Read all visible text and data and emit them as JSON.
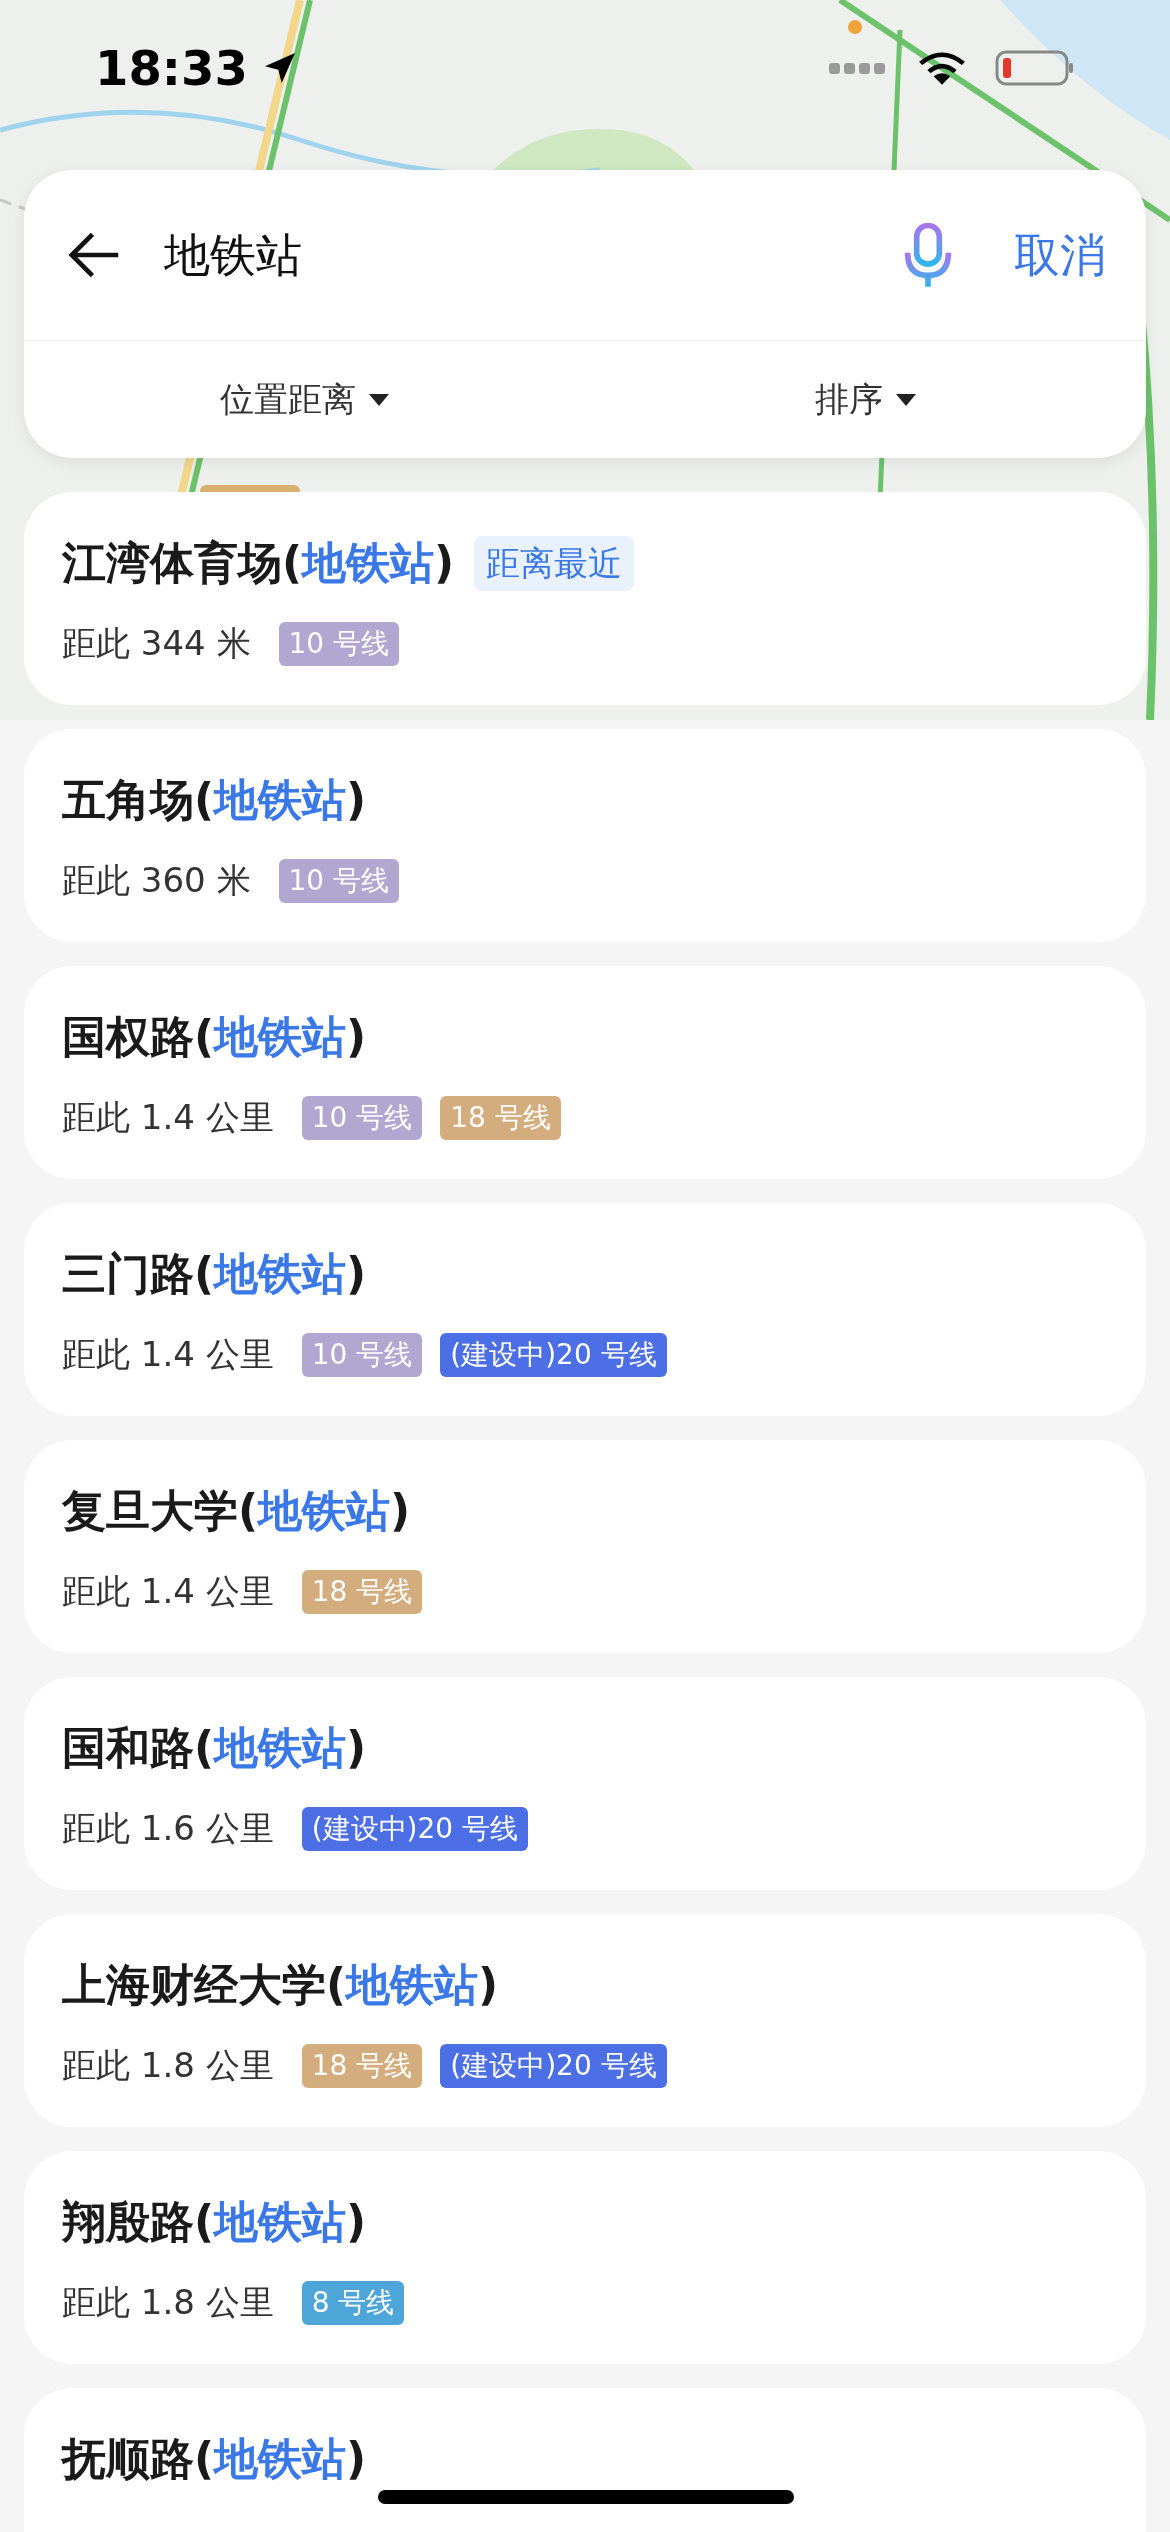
{
  "status_bar": {
    "time": "18:33"
  },
  "search": {
    "value": "地铁站",
    "cancel": "取消"
  },
  "filters": [
    {
      "label": "位置距离"
    },
    {
      "label": "排序"
    }
  ],
  "results": [
    {
      "prefix": "江湾体育场(",
      "highlight": "地铁站",
      "suffix": ")",
      "badge": "距离最近",
      "distance": "距此 344 米",
      "lines": [
        {
          "label": "10 号线",
          "color": "#b1a7d0"
        }
      ]
    },
    {
      "prefix": "五角场(",
      "highlight": "地铁站",
      "suffix": ")",
      "distance": "距此 360 米",
      "lines": [
        {
          "label": "10 号线",
          "color": "#b1a7d0"
        }
      ]
    },
    {
      "prefix": "国权路(",
      "highlight": "地铁站",
      "suffix": ")",
      "distance": "距此 1.4 公里",
      "lines": [
        {
          "label": "10 号线",
          "color": "#b1a7d0"
        },
        {
          "label": "18 号线",
          "color": "#d3ad7e"
        }
      ]
    },
    {
      "prefix": "三门路(",
      "highlight": "地铁站",
      "suffix": ")",
      "distance": "距此 1.4 公里",
      "lines": [
        {
          "label": "10 号线",
          "color": "#b1a7d0"
        },
        {
          "label": "(建设中)20 号线",
          "color": "#4d6fe6"
        }
      ]
    },
    {
      "prefix": "复旦大学(",
      "highlight": "地铁站",
      "suffix": ")",
      "distance": "距此 1.4 公里",
      "lines": [
        {
          "label": "18 号线",
          "color": "#d3ad7e"
        }
      ]
    },
    {
      "prefix": "国和路(",
      "highlight": "地铁站",
      "suffix": ")",
      "distance": "距此 1.6 公里",
      "lines": [
        {
          "label": "(建设中)20 号线",
          "color": "#4d6fe6"
        }
      ]
    },
    {
      "prefix": "上海财经大学(",
      "highlight": "地铁站",
      "suffix": ")",
      "distance": "距此 1.8 公里",
      "lines": [
        {
          "label": "18 号线",
          "color": "#d3ad7e"
        },
        {
          "label": "(建设中)20 号线",
          "color": "#4d6fe6"
        }
      ]
    },
    {
      "prefix": "翔殷路(",
      "highlight": "地铁站",
      "suffix": ")",
      "distance": "距此 1.8 公里",
      "lines": [
        {
          "label": "8 号线",
          "color": "#4ea6d8"
        }
      ]
    },
    {
      "prefix": "抚顺路(",
      "highlight": "地铁站",
      "suffix": ")"
    }
  ]
}
